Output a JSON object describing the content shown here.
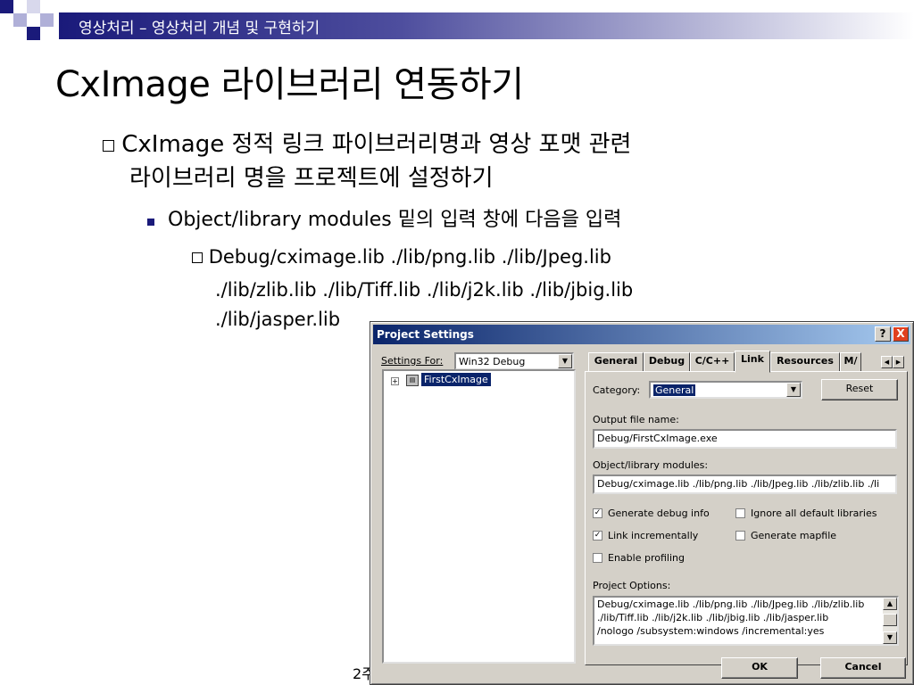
{
  "slide": {
    "header": "영상처리 – 영상처리 개념 및 구현하기",
    "title": "CxImage 라이브러리 연동하기",
    "bullet1_line1": "CxImage 정적 링크 파이브러리명과 영상 포맷 관련",
    "bullet1_line2": "라이브러리 명을 프로젝트에 설정하기",
    "bullet2": "Object/library modules 밑의 입력 창에 다음을 입력",
    "bullet3_line1": "Debug/cximage.lib ./lib/png.lib ./lib/Jpeg.lib",
    "bullet3_line2": "./lib/zlib.lib ./lib/Tiff.lib ./lib/j2k.lib ./lib/jbig.lib",
    "bullet3_line3": "./lib/jasper.lib",
    "page_number": "2주",
    "colors": {
      "header_bar": "#1a1a7a",
      "square_dark": "#1a1a7a",
      "square_light": "#b0b0d8"
    }
  },
  "dialog": {
    "title": "Project Settings",
    "help_button": "?",
    "close_button": "X",
    "settings_for_label": "Settings For:",
    "settings_for_value": "Win32 Debug",
    "tree_item": "FirstCxImage",
    "tabs": [
      "General",
      "Debug",
      "C/C++",
      "Link",
      "Resources",
      "M/"
    ],
    "active_tab": "Link",
    "category_label": "Category:",
    "category_value": "General",
    "reset_button": "Reset",
    "output_label": "Output file name:",
    "output_value": "Debug/FirstCxImage.exe",
    "modules_label": "Object/library modules:",
    "modules_value": "Debug/cximage.lib ./lib/png.lib ./lib/Jpeg.lib ./lib/zlib.lib ./li",
    "checkboxes": {
      "generate_debug": {
        "label": "Generate debug info",
        "checked": true
      },
      "ignore_default": {
        "label": "Ignore all default libraries",
        "checked": false
      },
      "link_incremental": {
        "label": "Link incrementally",
        "checked": true
      },
      "generate_mapfile": {
        "label": "Generate mapfile",
        "checked": false
      },
      "enable_profiling": {
        "label": "Enable profiling",
        "checked": false
      }
    },
    "project_options_label": "Project Options:",
    "project_options_lines": [
      "Debug/cximage.lib ./lib/png.lib ./lib/Jpeg.lib ./lib/zlib.lib",
      "./lib/Tiff.lib ./lib/j2k.lib ./lib/jbig.lib ./lib/jasper.lib",
      "/nologo /subsystem:windows /incremental:yes"
    ],
    "ok_button": "OK",
    "cancel_button": "Cancel",
    "colors": {
      "titlebar_start": "#0a246a",
      "titlebar_end": "#a6caf0",
      "face": "#d4d0c8"
    }
  }
}
